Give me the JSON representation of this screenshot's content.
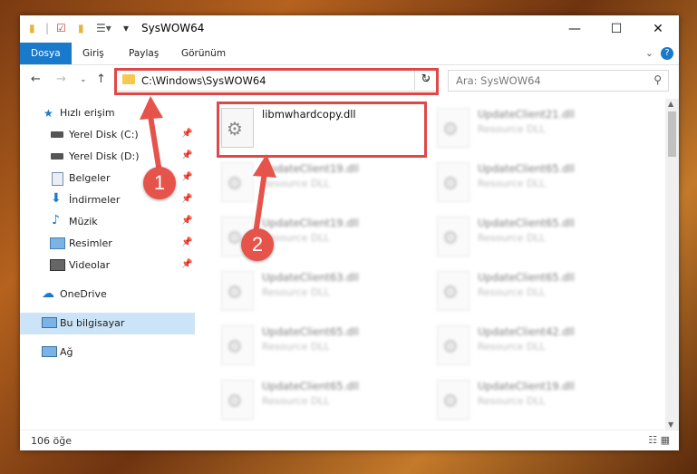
{
  "window": {
    "title": "SysWOW64"
  },
  "titlebar": {
    "minimize": "—",
    "maximize": "☐",
    "close": "✕"
  },
  "ribbon": {
    "tabs": [
      "Dosya",
      "Giriş",
      "Paylaş",
      "Görünüm"
    ],
    "collapse": "⌄",
    "help": "?"
  },
  "address": {
    "path": "C:\\Windows\\SysWOW64",
    "search_placeholder": "Ara: SysWOW64"
  },
  "nav": {
    "quick_access": "Hızlı erişim",
    "items": [
      "Yerel Disk (C:)",
      "Yerel Disk (D:)",
      "Belgeler",
      "İndirmeler",
      "Müzik",
      "Resimler",
      "Videolar"
    ],
    "onedrive": "OneDrive",
    "this_pc": "Bu bilgisayar",
    "network": "Ağ"
  },
  "files": [
    {
      "name": "libmwhardcopy.dll",
      "type": ""
    },
    {
      "name": "UpdateClient21.dll",
      "type": "Resource DLL"
    },
    {
      "name": "UpdateClient19.dll",
      "type": "Resource DLL"
    },
    {
      "name": "UpdateClient65.dll",
      "type": "Resource DLL"
    },
    {
      "name": "UpdateClient19.dll",
      "type": "Resource DLL"
    },
    {
      "name": "UpdateClient65.dll",
      "type": "Resource DLL"
    },
    {
      "name": "UpdateClient63.dll",
      "type": "Resource DLL"
    },
    {
      "name": "UpdateClient65.dll",
      "type": "Resource DLL"
    },
    {
      "name": "UpdateClient65.dll",
      "type": "Resource DLL"
    },
    {
      "name": "UpdateClient42.dll",
      "type": "Resource DLL"
    },
    {
      "name": "UpdateClient65.dll",
      "type": "Resource DLL"
    },
    {
      "name": "UpdateClient19.dll",
      "type": "Resource DLL"
    }
  ],
  "status": {
    "count": "106 öğe"
  },
  "annotations": {
    "one": "1",
    "two": "2"
  },
  "colors": {
    "accent": "#1979ca",
    "highlight": "#e04848",
    "badge": "#e5534b",
    "selected": "#cce4f7"
  }
}
